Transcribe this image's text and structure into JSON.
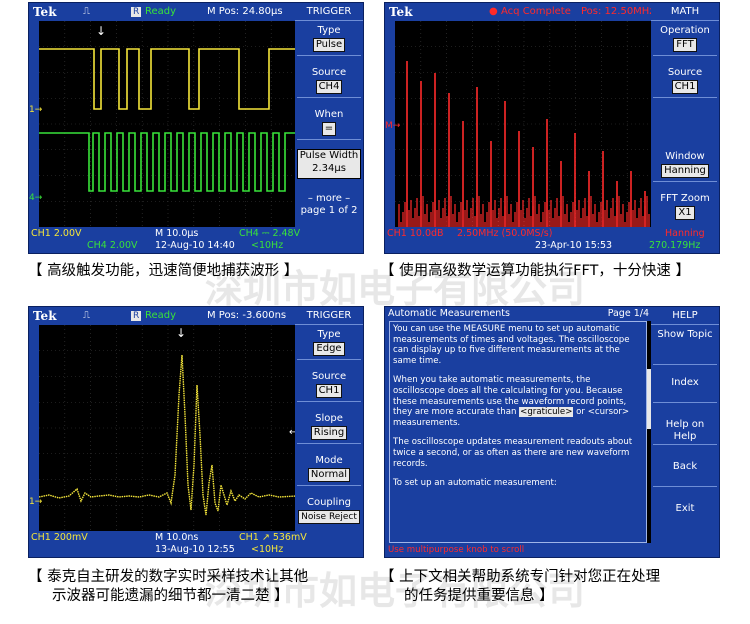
{
  "panel1": {
    "brand": "Tek",
    "status": "Ready",
    "badge": "R",
    "mpos": "M Pos: 24.80µs",
    "menu_title": "TRIGGER",
    "menu": [
      {
        "label": "Type",
        "value": "Pulse"
      },
      {
        "label": "Source",
        "value": "CH4"
      },
      {
        "label": "When",
        "value": "="
      },
      {
        "label": "Pulse Width",
        "value": "2.34µs"
      },
      {
        "label": "– more –",
        "value": "page 1 of 2"
      }
    ],
    "bottom": {
      "ch1": "CH1  2.00V",
      "ch4": "CH4  2.00V",
      "m": "M 10.0µs",
      "date": "12-Aug-10 14:40",
      "trig": "CH4 ⎓ 2.48V",
      "freq": "<10Hz"
    },
    "markers": {
      "ch1": "1→",
      "ch4": "4→"
    }
  },
  "panel2": {
    "brand": "Tek",
    "acq": "Acq Complete",
    "pos": "Pos: 12.50MHz",
    "menu_title": "MATH",
    "menu": [
      {
        "label": "Operation",
        "value": "FFT"
      },
      {
        "label": "Source",
        "value": "CH1"
      },
      {
        "label": "Window",
        "value": "Hanning"
      },
      {
        "label": "FFT Zoom",
        "value": "X1"
      }
    ],
    "bottom": {
      "ch1": "CH1  10.0dB",
      "rate": "2.50MHz (50.0MS/s)",
      "window": "Hanning",
      "date": "23-Apr-10 15:53",
      "freq": "270.179Hz"
    },
    "marker": "M→"
  },
  "panel3": {
    "brand": "Tek",
    "status": "Ready",
    "badge": "R",
    "mpos": "M Pos: -3.600ns",
    "menu_title": "TRIGGER",
    "menu": [
      {
        "label": "Type",
        "value": "Edge"
      },
      {
        "label": "Source",
        "value": "CH1"
      },
      {
        "label": "Slope",
        "value": "Rising"
      },
      {
        "label": "Mode",
        "value": "Normal"
      },
      {
        "label": "Coupling",
        "value": "Noise Reject"
      }
    ],
    "bottom": {
      "ch1": "CH1  200mV",
      "m": "M 10.0ns",
      "date": "13-Aug-10 12:55",
      "trig": "CH1 ↗ 536mV",
      "freq": "<10Hz"
    },
    "marker": "1→"
  },
  "panel4": {
    "title": "Automatic Measurements",
    "page": "Page 1/4",
    "menu_title": "HELP",
    "menu": [
      "Show Topic",
      "Index",
      "Help on Help",
      "Back",
      "Exit"
    ],
    "paragraphs": [
      "You can use the MEASURE menu to set up automatic measurements of times and voltages. The oscilloscope can display up to five different measurements at the same time.",
      "When you take automatic measurements, the oscilloscope does all the calculating for you. Because these measurements use the waveform record points, they are more accurate than",
      "The oscilloscope updates measurement readouts about twice a second, or as often as there are new waveform records.",
      "To set up an automatic measurement:"
    ],
    "link1": "<graticule>",
    "link_or": " or ",
    "link2": "<cursor>",
    "link_tail": " measurements.",
    "footer": "Use multipurpose knob to scroll"
  },
  "captions": {
    "c1": "【 高级触发功能，迅速简便地捕获波形 】",
    "c2": "【 使用高级数学运算功能执行FFT，十分快速 】",
    "c3a": "【 泰克自主研发的数字实时采样技术让其他",
    "c3b": "示波器可能遗漏的细节都一清二楚 】",
    "c4a": "【 上下文相关帮助系统专门针对您正在处理",
    "c4b": "的任务提供重要信息 】"
  },
  "watermark": "深圳市如电子有限公司"
}
